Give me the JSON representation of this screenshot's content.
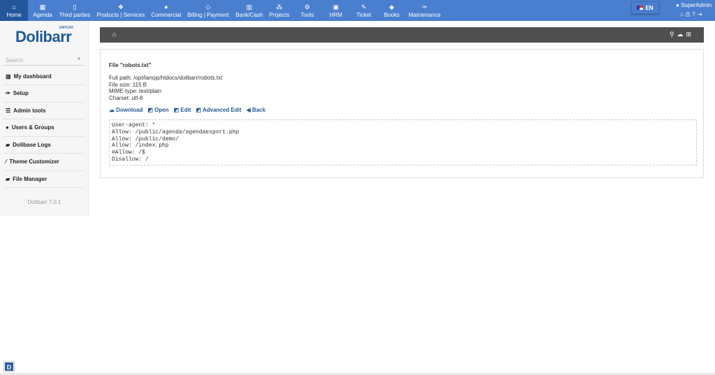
{
  "topnav": [
    {
      "label": "Home",
      "icon": "home-icon",
      "glyph": "⌂"
    },
    {
      "label": "Agenda",
      "icon": "calendar-icon",
      "glyph": "▦"
    },
    {
      "label": "Third parties",
      "icon": "building-icon",
      "glyph": "▯"
    },
    {
      "label": "Products | Services",
      "icon": "cubes-icon",
      "glyph": "❖"
    },
    {
      "label": "Commercial",
      "icon": "user-icon",
      "glyph": "●"
    },
    {
      "label": "Billing | Payment",
      "icon": "diamond-icon",
      "glyph": "◇"
    },
    {
      "label": "Bank/Cash",
      "icon": "bank-icon",
      "glyph": "▥"
    },
    {
      "label": "Projects",
      "icon": "sitemap-icon",
      "glyph": "⁂"
    },
    {
      "label": "Tools",
      "icon": "cogs-icon",
      "glyph": "⚙"
    },
    {
      "label": "HRM",
      "icon": "id-card-icon",
      "glyph": "▣"
    },
    {
      "label": "Ticket",
      "icon": "ticket-icon",
      "glyph": "✎"
    },
    {
      "label": "Books",
      "icon": "books-icon",
      "glyph": "◆"
    },
    {
      "label": "Maintenance",
      "icon": "wrench-icon",
      "glyph": "✑"
    }
  ],
  "lang": "EN",
  "user": "SuperAdmin",
  "logo": {
    "name": "Dolibarr",
    "tag": "ERP/CRM"
  },
  "search_placeholder": "Search",
  "sidebar": [
    {
      "label": "My dashboard",
      "icon": "chart-icon",
      "glyph": "▥"
    },
    {
      "label": "Setup",
      "icon": "wrench-icon",
      "glyph": "✑"
    },
    {
      "label": "Admin tools",
      "icon": "list-icon",
      "glyph": "☰"
    },
    {
      "label": "Users & Groups",
      "icon": "users-icon",
      "glyph": "●"
    },
    {
      "label": "Dolibase Logs",
      "icon": "book-icon",
      "glyph": "▰"
    },
    {
      "label": "Theme Customizer",
      "icon": "brush-icon",
      "glyph": "⁄"
    },
    {
      "label": "File Manager",
      "icon": "folder-open-icon",
      "glyph": "▰"
    }
  ],
  "version": "Dolibarr 7.0.1",
  "file": {
    "title": "File \"robots.txt\"",
    "full_path": "Full path: /opt/lampp/htdocs/dolibarr/robots.txt",
    "size": "File size: 115 B",
    "mime": "MIME-type: text/plain",
    "charset": "Charset: utf-8",
    "content": "User-agent: *\nAllow: /public/agenda/agendaexport.php\nAllow: /public/demo/\nAllow: /index.php\n#Allow: /$\nDisallow: /"
  },
  "actions": [
    {
      "label": "Download",
      "icon": "cloud-download-icon",
      "glyph": "☁"
    },
    {
      "label": "Open",
      "icon": "external-icon",
      "glyph": "◩"
    },
    {
      "label": "Edit",
      "icon": "edit-icon",
      "glyph": "◩"
    },
    {
      "label": "Advanced Edit",
      "icon": "edit-icon",
      "glyph": "◩"
    },
    {
      "label": "Back",
      "icon": "back-icon",
      "glyph": "◀"
    }
  ],
  "bottom_badge": "D"
}
